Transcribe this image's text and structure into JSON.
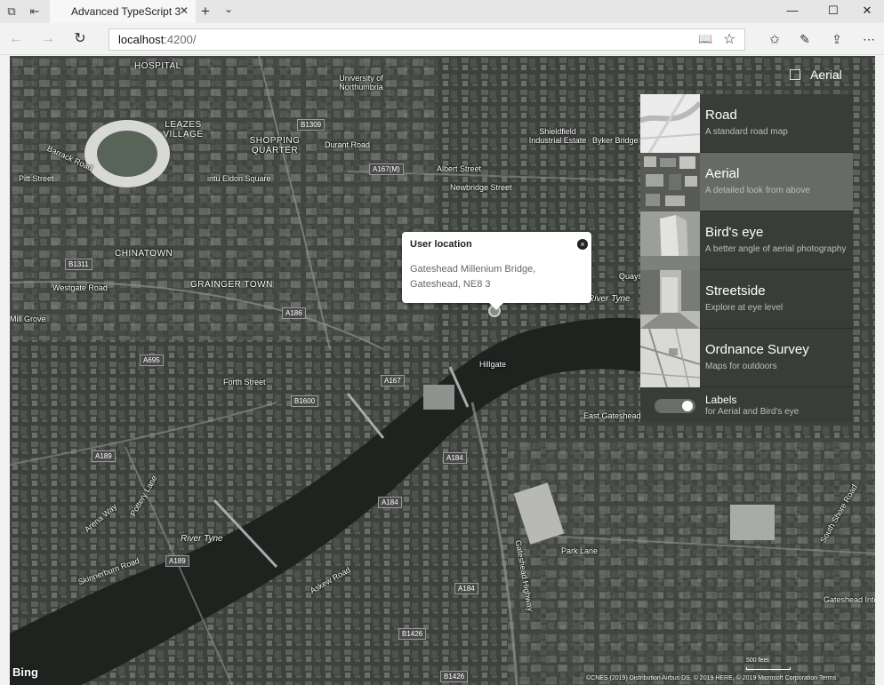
{
  "browser": {
    "tab_title": "Advanced TypeScript 3",
    "tab_close": "✕",
    "new_tab": "+",
    "tab_list": "⌄",
    "url_host": "localhost",
    "url_rest": ":4200/",
    "window_controls": {
      "minimize": "—",
      "maximize": "☐",
      "close": "✕"
    },
    "nav": {
      "back": "←",
      "forward": "→",
      "refresh": "↻"
    },
    "tools": {
      "favorites": "✩",
      "notes": "✎",
      "share": "⇪",
      "more": "⋯"
    }
  },
  "infobox": {
    "title": "User location",
    "close_glyph": "×",
    "line1": "Gateshead Millenium Bridge,",
    "line2": "Gateshead, NE8 3"
  },
  "style_picker": {
    "current": "Aerial",
    "items": [
      {
        "name": "Road",
        "desc": "A standard road map",
        "active": false
      },
      {
        "name": "Aerial",
        "desc": "A detailed look from above",
        "active": true
      },
      {
        "name": "Bird's eye",
        "desc": "A better angle of aerial photography",
        "active": false
      },
      {
        "name": "Streetside",
        "desc": "Explore at eye level",
        "active": false
      },
      {
        "name": "Ordnance Survey",
        "desc": "Maps for outdoors",
        "active": false
      }
    ],
    "labels": {
      "title": "Labels",
      "desc": "for Aerial and Bird's eye",
      "enabled": true
    }
  },
  "map": {
    "labels": {
      "hospital": "HOSPITAL",
      "university": "University of Northumbria",
      "leazes": "LEAZES VILLAGE",
      "shopping": "SHOPPING QUARTER",
      "eldon": "intu Eldon Square",
      "chinatown": "CHINATOWN",
      "grainger": "GRAINGER TOWN",
      "westgate": "Westgate Road",
      "mill_grove": "Mill Grove",
      "river_tyne_1": "River Tyne",
      "river_tyne_2": "River Tyne",
      "shieldfield": "Shieldfield Industrial Estate",
      "newbridge": "Newbridge Street",
      "albert": "Albert Street",
      "byker": "Byker Bridge",
      "east_gateshead": "East Gateshead Ind",
      "park_lane": "Park Lane",
      "gateshead_highway": "Gateshead Highway",
      "arena_way": "Arena Way",
      "pottery_lane": "Pottery Lane",
      "skinnerburn": "Skinnerburn Road",
      "askew": "Askew Road",
      "hillgate": "Hillgate",
      "quayside": "Quayside",
      "forth_street": "Forth Street",
      "gateshead_inter": "Gateshead Inter",
      "south_shore": "South Shore Road",
      "pitt_street": "Pitt Street",
      "barrack_road": "Barrack Road",
      "durant_road": "Durant Road"
    },
    "roads": [
      "B1309",
      "A167(M)",
      "B1311",
      "A186",
      "A695",
      "A167",
      "B1600",
      "A189",
      "A184",
      "A184",
      "A189",
      "A184",
      "B1426",
      "B1426"
    ],
    "bing": "Bing",
    "copyright": "©CNES (2019) Distribution Airbus DS, © 2019 HERE, © 2019 Microsoft Corporation Terms",
    "scale": "500 feet"
  }
}
